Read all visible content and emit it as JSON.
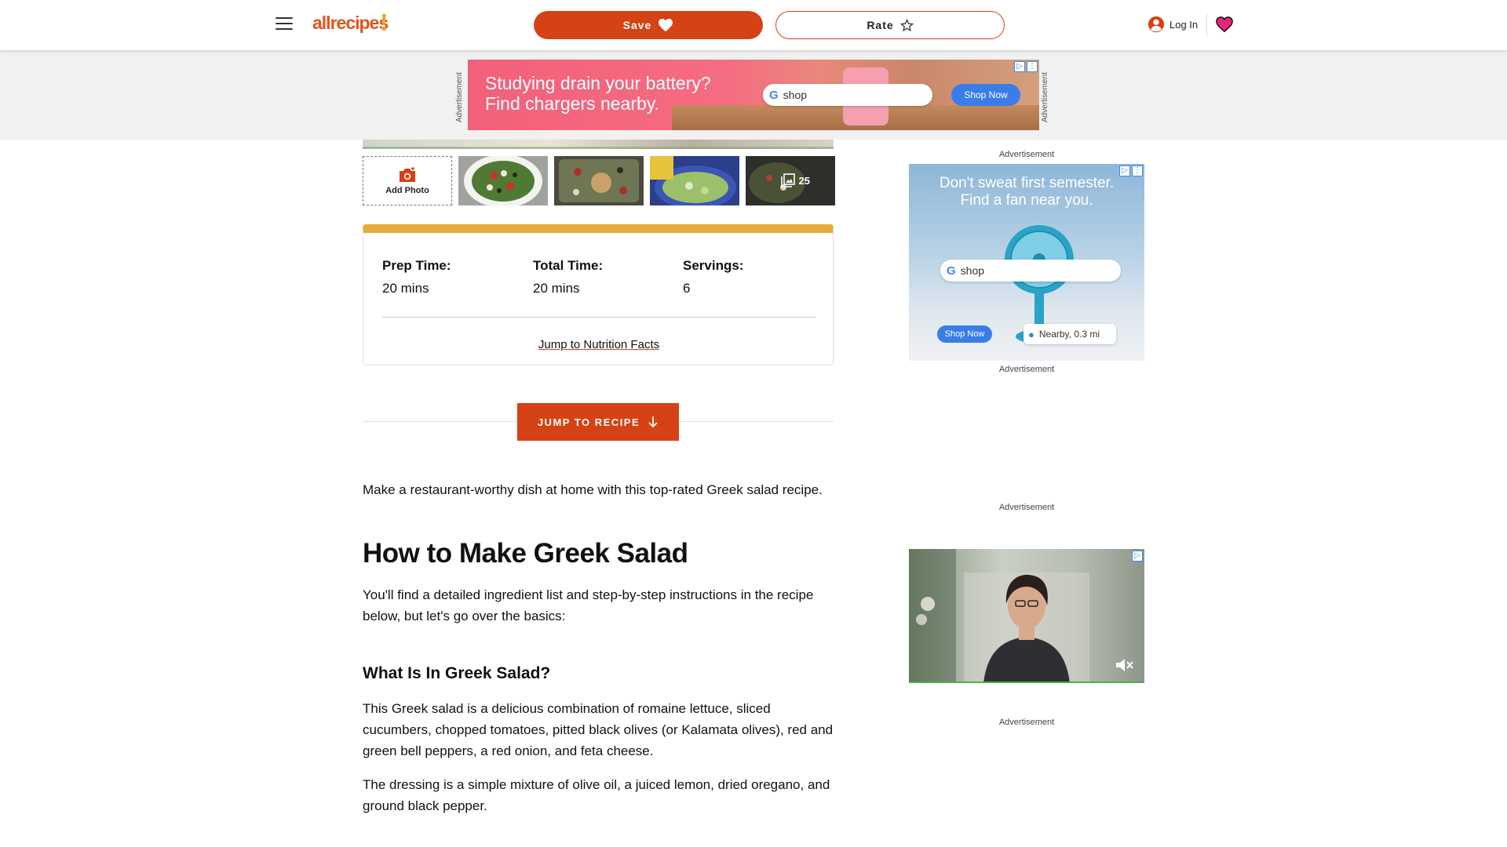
{
  "header": {
    "logo": "allrecipes",
    "save_label": "Save",
    "rate_label": "Rate",
    "login_label": "Log In"
  },
  "top_ad": {
    "side_label": "Advertisement",
    "line1": "Studying drain your battery?",
    "line2": "Find chargers nearby.",
    "shop_label": "shop",
    "cta": "Shop Now"
  },
  "gallery": {
    "add_photo_label": "Add Photo",
    "photo_count": "25"
  },
  "info": {
    "prep_label": "Prep Time:",
    "prep_value": "20 mins",
    "total_label": "Total Time:",
    "total_value": "20 mins",
    "servings_label": "Servings:",
    "servings_value": "6",
    "nutrition_link": "Jump to Nutrition Facts"
  },
  "jump": {
    "label": "JUMP TO RECIPE"
  },
  "article": {
    "intro": "Make a restaurant-worthy dish at home with this top-rated Greek salad recipe.",
    "heading": "How to Make Greek Salad",
    "p1": "You'll find a detailed ingredient list and step-by-step instructions in the recipe below, but let's go over the basics:",
    "subheading": "What Is In Greek Salad?",
    "p2": "This Greek salad is a delicious combination of romaine lettuce, sliced cucumbers, chopped tomatoes, pitted black olives (or Kalamata olives), red and green bell peppers, a red onion, and feta cheese.",
    "p3": "The dressing is a simple mixture of olive oil, a juiced lemon, dried oregano, and ground black pepper."
  },
  "side_ads": {
    "label": "Advertisement",
    "ad1_line1": "Don't sweat first semester.",
    "ad1_line2": "Find a fan near you.",
    "ad1_shop": "shop",
    "ad1_cta": "Shop Now",
    "ad1_nearby": "Nearby, 0.3 mi"
  },
  "colors": {
    "brand": "#d54215",
    "accent_bar": "#e5a93c",
    "heart": "#e8257a"
  }
}
